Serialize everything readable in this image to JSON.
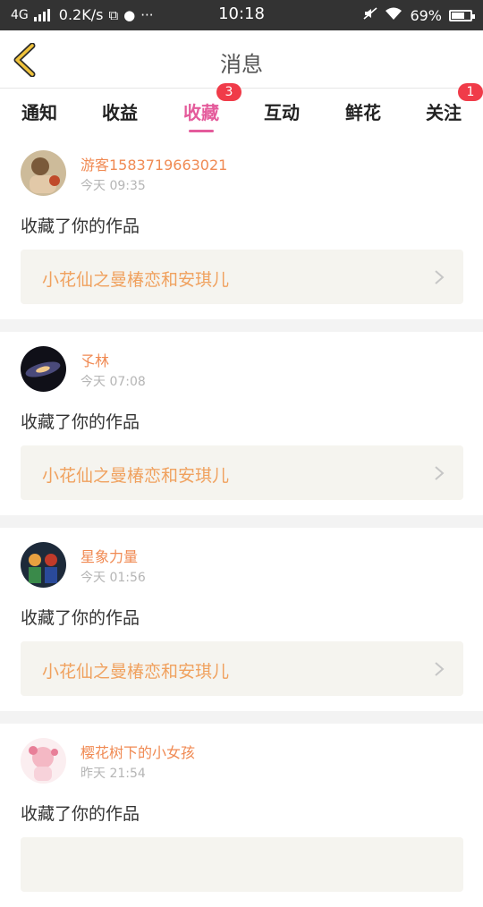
{
  "status_bar": {
    "network": "4G",
    "speed": "0.2K/s",
    "time": "10:18",
    "battery": "69%",
    "battery_level": 0.69
  },
  "nav": {
    "title": "消息",
    "back_icon": "chevron-left-icon",
    "accent": "#f0c33c"
  },
  "tabs": [
    {
      "label": "通知",
      "badge": ""
    },
    {
      "label": "收益",
      "badge": ""
    },
    {
      "label": "收藏",
      "badge": "3",
      "active": true
    },
    {
      "label": "互动",
      "badge": ""
    },
    {
      "label": "鲜花",
      "badge": ""
    },
    {
      "label": "关注",
      "badge": "1"
    }
  ],
  "colors": {
    "active_tab": "#e45b9b",
    "username": "#f08a53",
    "work_title": "#f0a15e",
    "badge": "#f03b49"
  },
  "messages": [
    {
      "user": "游客1583719663021",
      "time": "今天 09:35",
      "action": "收藏了你的作品",
      "work": "小花仙之曼椿恋和安琪儿"
    },
    {
      "user": "孓林",
      "time": "今天 07:08",
      "action": "收藏了你的作品",
      "work": "小花仙之曼椿恋和安琪儿"
    },
    {
      "user": "星象力量",
      "time": "今天 01:56",
      "action": "收藏了你的作品",
      "work": "小花仙之曼椿恋和安琪儿"
    },
    {
      "user": "樱花树下的小女孩",
      "time": "昨天 21:54",
      "action": "收藏了你的作品",
      "work": ""
    }
  ]
}
